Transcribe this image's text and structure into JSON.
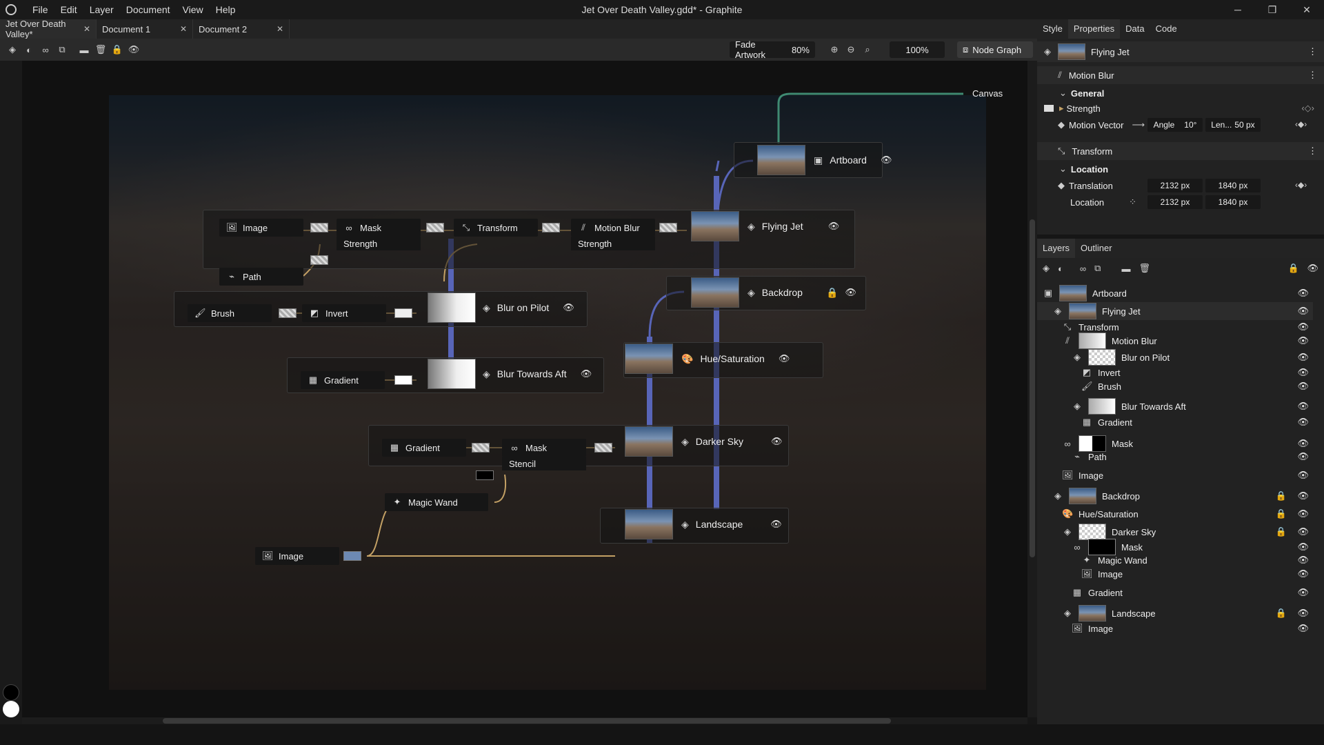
{
  "app": {
    "window_title": "Jet Over Death Valley.gdd* - Graphite",
    "menu": [
      "File",
      "Edit",
      "Layer",
      "Document",
      "View",
      "Help"
    ]
  },
  "doc_tabs": [
    {
      "label": "Jet Over Death Valley*",
      "active": true
    },
    {
      "label": "Document 1",
      "active": false
    },
    {
      "label": "Document 2",
      "active": false
    }
  ],
  "toolbar": {
    "fade_label": "Fade Artwork",
    "fade_value": "80%",
    "zoom": "100%",
    "node_graph_label": "Node Graph"
  },
  "graph": {
    "canvas_label": "Canvas",
    "layers": {
      "artboard": "Artboard",
      "flying_jet": "Flying Jet",
      "backdrop": "Backdrop",
      "blur_on_pilot": "Blur on Pilot",
      "hue_saturation": "Hue/Saturation",
      "blur_towards_aft": "Blur Towards Aft",
      "darker_sky": "Darker Sky",
      "landscape": "Landscape"
    },
    "nodes": {
      "image1": "Image",
      "mask1": "Mask",
      "mask1_param": "Strength",
      "transform": "Transform",
      "motion_blur": "Motion Blur",
      "motion_blur_param": "Strength",
      "path": "Path",
      "brush": "Brush",
      "invert": "Invert",
      "gradient1": "Gradient",
      "gradient2": "Gradient",
      "mask2": "Mask",
      "mask2_param": "Stencil",
      "magic_wand": "Magic Wand",
      "image2": "Image"
    }
  },
  "properties": {
    "tabs": [
      "Style",
      "Properties",
      "Data",
      "Code"
    ],
    "layer_name": "Flying Jet",
    "motion_blur": {
      "title": "Motion Blur",
      "section": "General",
      "strength_label": "Strength",
      "motion_vector_label": "Motion Vector",
      "angle_label": "Angle",
      "angle_value": "10°",
      "length_label": "Len...",
      "length_value": "50 px"
    },
    "transform": {
      "title": "Transform",
      "section": "Location",
      "translation_label": "Translation",
      "translation_x": "2132 px",
      "translation_y": "1840 px",
      "location_label": "Location",
      "location_x": "2132 px",
      "location_y": "1840 px"
    }
  },
  "layers_panel": {
    "tabs": [
      "Layers",
      "Outliner"
    ],
    "rows": [
      {
        "label": "Artboard",
        "indent": 0
      },
      {
        "label": "Flying Jet",
        "indent": 1
      },
      {
        "label": "Transform",
        "indent": 2
      },
      {
        "label": "Motion Blur",
        "indent": 2
      },
      {
        "label": "Blur on Pilot",
        "indent": 3
      },
      {
        "label": "Invert",
        "indent": 4
      },
      {
        "label": "Brush",
        "indent": 4
      },
      {
        "label": "Blur Towards Aft",
        "indent": 3
      },
      {
        "label": "Gradient",
        "indent": 4
      },
      {
        "label": "Mask",
        "indent": 2
      },
      {
        "label": "Path",
        "indent": 3
      },
      {
        "label": "Image",
        "indent": 2
      },
      {
        "label": "Backdrop",
        "indent": 1
      },
      {
        "label": "Hue/Saturation",
        "indent": 2
      },
      {
        "label": "Darker Sky",
        "indent": 2
      },
      {
        "label": "Mask",
        "indent": 3
      },
      {
        "label": "Magic Wand",
        "indent": 4
      },
      {
        "label": "Image",
        "indent": 4
      },
      {
        "label": "Gradient",
        "indent": 3
      },
      {
        "label": "Landscape",
        "indent": 2
      },
      {
        "label": "Image",
        "indent": 3
      }
    ]
  },
  "colors": {
    "wire_blue": "#5865b8",
    "wire_gold": "#c4a165",
    "wire_green": "#3f8a72",
    "accent": "#6b7bd8"
  }
}
